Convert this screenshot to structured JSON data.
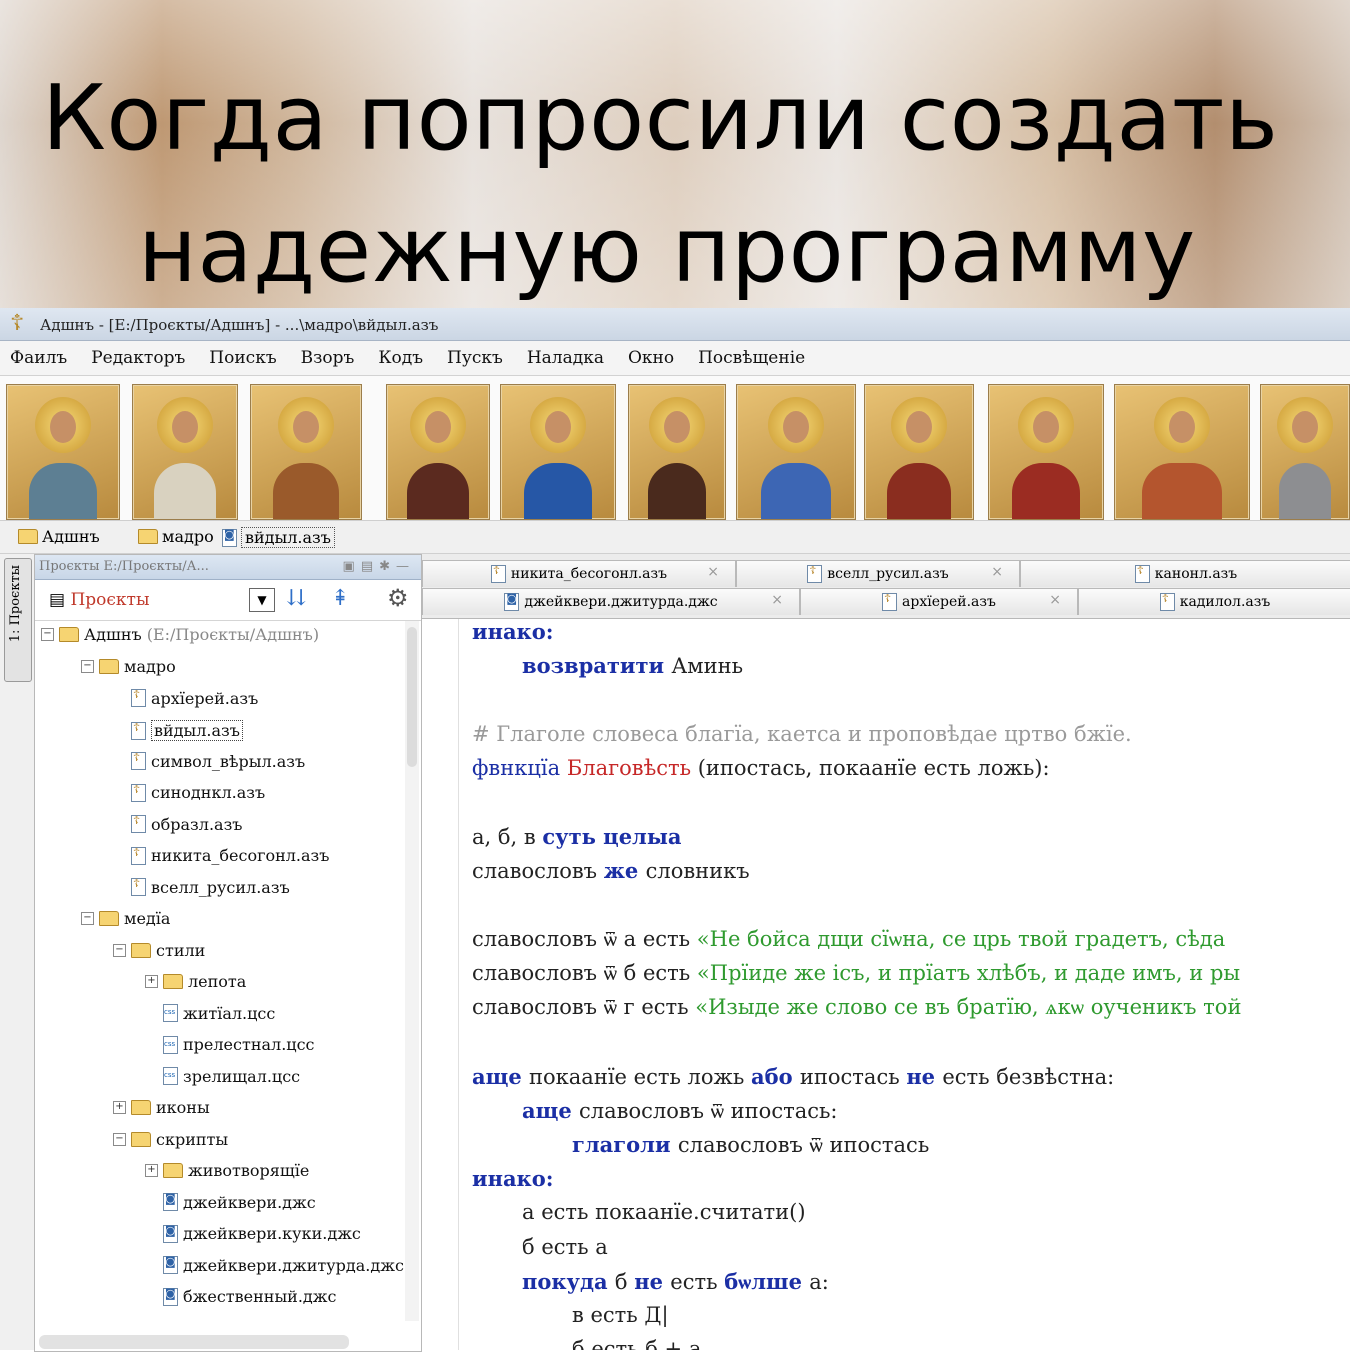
{
  "meme": {
    "line1": "Когда попросили создать",
    "line2": "надежную программу"
  },
  "window": {
    "title": "Адшнъ - [Е:/Проєкты/Адшнъ] - ...\\мадро\\вйдыл.азъ"
  },
  "menu": [
    "Фаилъ",
    "Редакторъ",
    "Поискъ",
    "Взоръ",
    "Кодъ",
    "Пускъ",
    "Наладка",
    "Окно",
    "Посвѣщеніе"
  ],
  "icons": [
    {
      "name": "trinity-icon",
      "robe": "#5d7f93"
    },
    {
      "name": "savior-not-made-by-hands-icon",
      "robe": "#d9d2c0"
    },
    {
      "name": "savior-icon",
      "robe": "#9a5a2b"
    },
    {
      "name": "theotokos-hodegetria-icon",
      "robe": "#5b2a1f"
    },
    {
      "name": "theotokos-blue-icon",
      "robe": "#2657a6"
    },
    {
      "name": "christ-pantocrator-icon",
      "robe": "#4a2a1d"
    },
    {
      "name": "theotokos-with-child-icon",
      "robe": "#3d66b4"
    },
    {
      "name": "christ-with-book-icon",
      "robe": "#8a2d1f"
    },
    {
      "name": "theotokos-red-icon",
      "robe": "#9b2c22"
    },
    {
      "name": "christ-enthroned-icon",
      "robe": "#b4552e"
    },
    {
      "name": "silver-riza-christ-icon",
      "robe": "#8d8e91"
    }
  ],
  "breadcrumb": [
    "Адшнъ",
    "мадро",
    "вйдыл.азъ"
  ],
  "side_tab": "1: Проєкты",
  "project_panel": {
    "header": "Проєкты Е:/Проєкты/А...",
    "selector": "Проєкты",
    "root": {
      "name": "Адшнъ",
      "path": "(Е:/Проєкты/Адшнъ)"
    },
    "tree": [
      {
        "label": "мадро",
        "type": "folder",
        "expanded": true,
        "depth": 1
      },
      {
        "label": "архїерей.азъ",
        "type": "file",
        "depth": 2
      },
      {
        "label": "вйдыл.азъ",
        "type": "file",
        "depth": 2,
        "selected": true
      },
      {
        "label": "символ_вѣрыл.азъ",
        "type": "file",
        "depth": 2
      },
      {
        "label": "синоднкл.азъ",
        "type": "file",
        "depth": 2
      },
      {
        "label": "образл.азъ",
        "type": "file",
        "depth": 2
      },
      {
        "label": "никита_бесогонл.азъ",
        "type": "file",
        "depth": 2
      },
      {
        "label": "вселл_русил.азъ",
        "type": "file",
        "depth": 2
      },
      {
        "label": "медїа",
        "type": "folder",
        "expanded": true,
        "depth": 1
      },
      {
        "label": "стили",
        "type": "folder",
        "expanded": true,
        "depth": 2
      },
      {
        "label": "лепота",
        "type": "folder",
        "expanded": false,
        "depth": 3
      },
      {
        "label": "житїал.цсс",
        "type": "css",
        "depth": 3
      },
      {
        "label": "прелестнал.цсс",
        "type": "css",
        "depth": 3
      },
      {
        "label": "зрелищал.цсс",
        "type": "css",
        "depth": 3
      },
      {
        "label": "иконы",
        "type": "folder",
        "expanded": false,
        "depth": 2
      },
      {
        "label": "скрипты",
        "type": "folder",
        "expanded": true,
        "depth": 2
      },
      {
        "label": "животворящїе",
        "type": "folder",
        "expanded": false,
        "depth": 3
      },
      {
        "label": "джейквери.джс",
        "type": "js",
        "depth": 3
      },
      {
        "label": "джейквери.куки.джс",
        "type": "js",
        "depth": 3
      },
      {
        "label": "джейквери.джитурда.джс",
        "type": "js",
        "depth": 3
      },
      {
        "label": "бжественный.джс",
        "type": "js",
        "depth": 3
      }
    ]
  },
  "editor": {
    "tabs_row1": [
      "никита_бесогонл.азъ",
      "вселл_русил.азъ",
      "канонл.азъ"
    ],
    "tabs_row2": [
      "джейквери.джитурда.джс",
      "архїерей.азъ",
      "кадилол.азъ"
    ],
    "code": [
      {
        "indent": 2,
        "parts": [
          {
            "c": "kw",
            "t": "инако:"
          }
        ]
      },
      {
        "indent": 3,
        "parts": [
          {
            "c": "kw",
            "t": "возвратити "
          },
          {
            "c": "plain",
            "t": "Аминь"
          }
        ]
      },
      {
        "indent": 0,
        "parts": []
      },
      {
        "indent": 2,
        "parts": [
          {
            "c": "cm",
            "t": "# Глаголе словеса благїа, каетса и проповѣдае цртво бжїе."
          }
        ]
      },
      {
        "indent": 0,
        "parts": [
          {
            "c": "kw2",
            "t": "фвнкцїа "
          },
          {
            "c": "fnname",
            "t": "Благовѣсть "
          },
          {
            "c": "plain",
            "t": "(ипостась, покаанїе есть ложь):"
          }
        ]
      },
      {
        "indent": 0,
        "parts": []
      },
      {
        "indent": 2,
        "parts": [
          {
            "c": "plain",
            "t": "а, б, в "
          },
          {
            "c": "kw",
            "t": "суть целыа"
          }
        ]
      },
      {
        "indent": 2,
        "parts": [
          {
            "c": "plain",
            "t": "славословъ "
          },
          {
            "c": "kw",
            "t": "же "
          },
          {
            "c": "plain",
            "t": "словникъ"
          }
        ]
      },
      {
        "indent": 0,
        "parts": []
      },
      {
        "indent": 2,
        "parts": [
          {
            "c": "plain",
            "t": "славословъ ѿ а есть "
          },
          {
            "c": "str",
            "t": "«Не бойса дщи сїѡна, се црь твой градетъ, сѣда"
          }
        ]
      },
      {
        "indent": 2,
        "parts": [
          {
            "c": "plain",
            "t": "славословъ ѿ б есть "
          },
          {
            "c": "str",
            "t": "«Прїиде же ісъ, и прїатъ хлѣбъ, и даде имъ, и ры"
          }
        ]
      },
      {
        "indent": 2,
        "parts": [
          {
            "c": "plain",
            "t": "славословъ ѿ г есть "
          },
          {
            "c": "str",
            "t": "«Изыде же слово се въ братїю, ѧкѡ оученикъ той"
          }
        ]
      },
      {
        "indent": 0,
        "parts": []
      },
      {
        "indent": 2,
        "parts": [
          {
            "c": "kw",
            "t": "аще "
          },
          {
            "c": "plain",
            "t": "покаанїе есть ложь "
          },
          {
            "c": "kw",
            "t": "або "
          },
          {
            "c": "plain",
            "t": "ипостась "
          },
          {
            "c": "kw",
            "t": "не "
          },
          {
            "c": "plain",
            "t": "есть безвѣстна:"
          }
        ]
      },
      {
        "indent": 3,
        "parts": [
          {
            "c": "kw",
            "t": "аще "
          },
          {
            "c": "plain",
            "t": "славословъ ѿ ипостась:"
          }
        ]
      },
      {
        "indent": 4,
        "parts": [
          {
            "c": "kw",
            "t": "глаголи "
          },
          {
            "c": "plain",
            "t": "славословъ ѿ ипостась"
          }
        ]
      },
      {
        "indent": 2,
        "parts": [
          {
            "c": "kw",
            "t": "инако:"
          }
        ]
      },
      {
        "indent": 3,
        "parts": [
          {
            "c": "plain",
            "t": "а есть покаанїе.считати()"
          }
        ]
      },
      {
        "indent": 3,
        "parts": [
          {
            "c": "plain",
            "t": "б есть а"
          }
        ]
      },
      {
        "indent": 3,
        "parts": [
          {
            "c": "kw",
            "t": "покуда "
          },
          {
            "c": "plain",
            "t": "б "
          },
          {
            "c": "kw",
            "t": "не "
          },
          {
            "c": "plain",
            "t": "есть "
          },
          {
            "c": "kw",
            "t": "бѡлше "
          },
          {
            "c": "plain",
            "t": "а:"
          }
        ]
      },
      {
        "indent": 4,
        "parts": [
          {
            "c": "plain",
            "t": "в есть Д|"
          }
        ]
      },
      {
        "indent": 4,
        "parts": [
          {
            "c": "plain",
            "t": "б есть б + а"
          }
        ]
      }
    ]
  }
}
